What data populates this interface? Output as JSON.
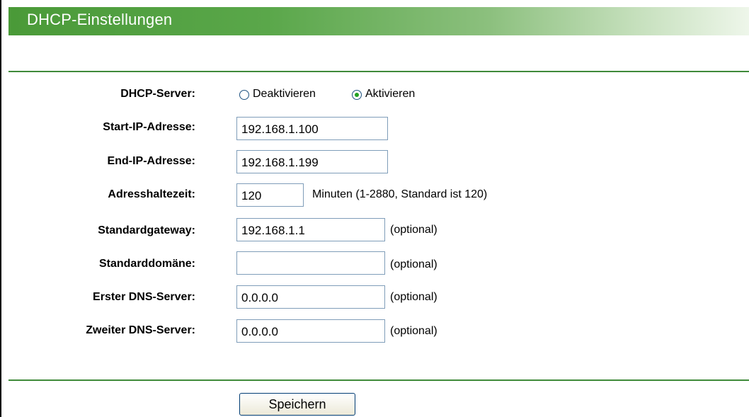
{
  "header": {
    "title": "DHCP-Einstellungen"
  },
  "form": {
    "dhcp_server": {
      "label": "DHCP-Server:",
      "options": [
        {
          "label": "Deaktivieren",
          "checked": false
        },
        {
          "label": "Aktivieren",
          "checked": true
        }
      ]
    },
    "start_ip": {
      "label": "Start-IP-Adresse:",
      "value": "192.168.1.100"
    },
    "end_ip": {
      "label": "End-IP-Adresse:",
      "value": "192.168.1.199"
    },
    "lease_time": {
      "label": "Adresshaltezeit:",
      "value": "120",
      "hint": "Minuten (1-2880, Standard ist 120)"
    },
    "default_gateway": {
      "label": "Standardgateway:",
      "value": "192.168.1.1",
      "hint": "(optional)"
    },
    "default_domain": {
      "label": "Standarddomäne:",
      "value": "",
      "hint": "(optional)"
    },
    "primary_dns": {
      "label": "Erster DNS-Server:",
      "value": "0.0.0.0",
      "hint": "(optional)"
    },
    "secondary_dns": {
      "label": "Zweiter DNS-Server:",
      "value": "0.0.0.0",
      "hint": "(optional)"
    }
  },
  "actions": {
    "save_label": "Speichern"
  },
  "colors": {
    "title_green": "#4a9a38",
    "rule_green": "#3f8a3a",
    "radio_checked": "#21a121"
  }
}
